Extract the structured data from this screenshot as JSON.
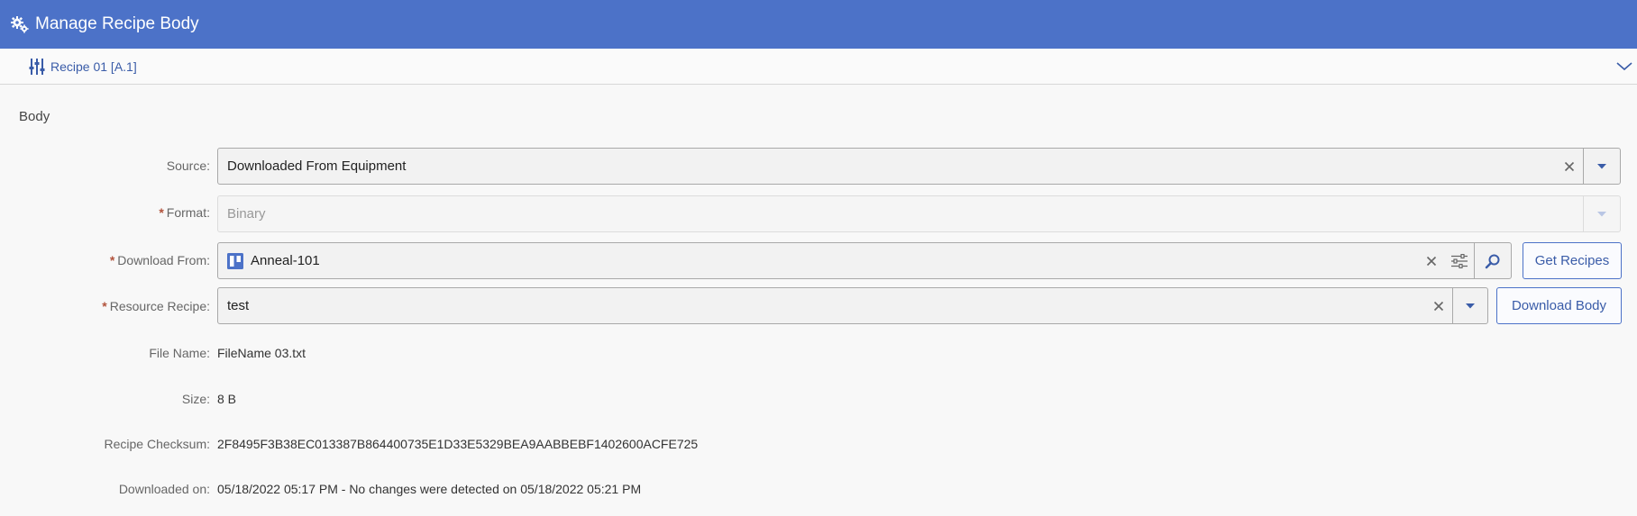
{
  "header": {
    "title": "Manage Recipe Body",
    "icon": "gears-icon"
  },
  "entity": {
    "label": "Recipe 01 [A.1]",
    "icon": "recipe-sliders-icon"
  },
  "section": {
    "title": "Body"
  },
  "form": {
    "source": {
      "label": "Source:",
      "value": "Downloaded From Equipment"
    },
    "format": {
      "label": "Format:",
      "value": "Binary",
      "required": true,
      "disabled": true
    },
    "download_from": {
      "label": "Download From:",
      "value": "Anneal-101",
      "required": true,
      "button": "Get Recipes"
    },
    "resource_recipe": {
      "label": "Resource Recipe:",
      "value": "test",
      "required": true,
      "button": "Download Body"
    },
    "file_name": {
      "label": "File Name:",
      "value": "FileName 03.txt"
    },
    "size": {
      "label": "Size:",
      "value": "8 B"
    },
    "checksum": {
      "label": "Recipe Checksum:",
      "value": "2F8495F3B38EC013387B864400735E1D33E5329BEA9AABBEBF1402600ACFE725"
    },
    "downloaded_on": {
      "label": "Downloaded on:",
      "value": "05/18/2022 05:17 PM - No changes were detected on 05/18/2022 05:21 PM"
    }
  },
  "colors": {
    "accent": "#4c72c8",
    "required": "#b2533c",
    "link": "#3a5ca8"
  }
}
